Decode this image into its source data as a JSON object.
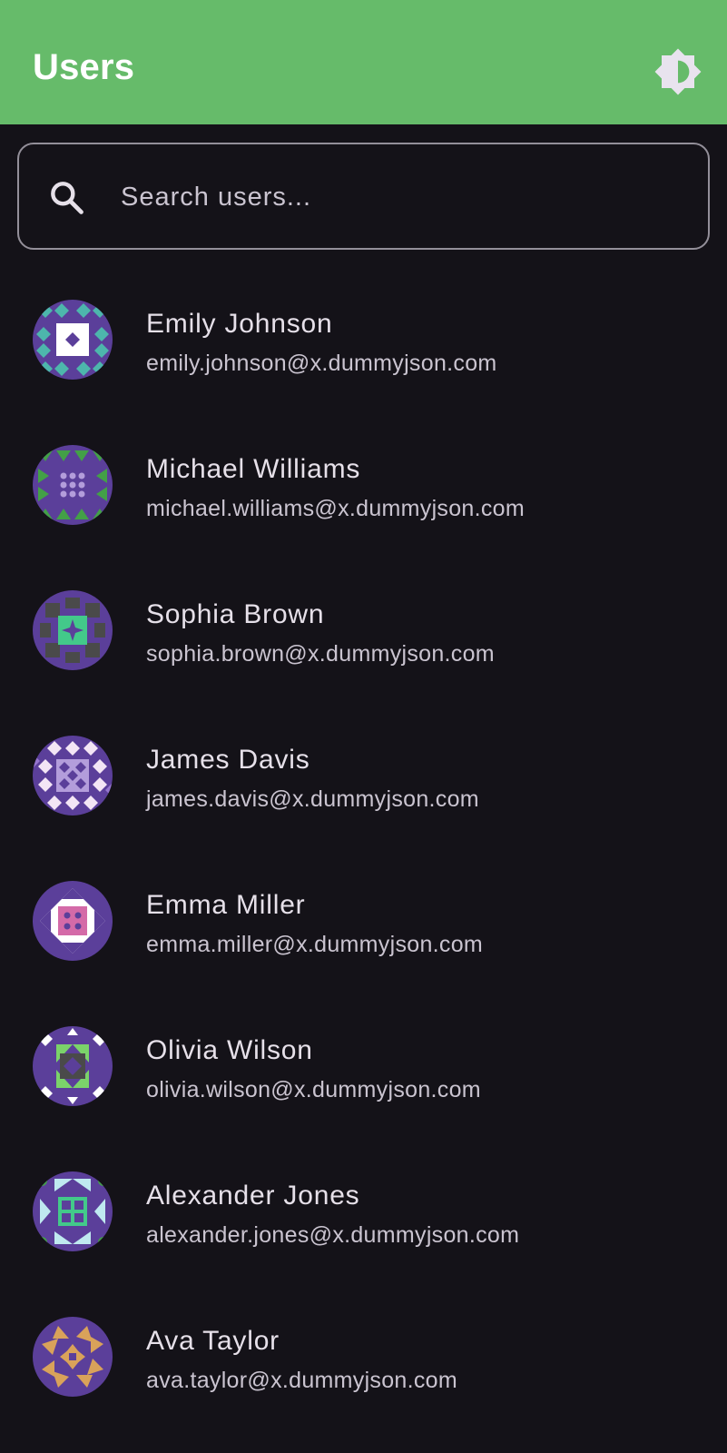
{
  "app_bar": {
    "title": "Users",
    "background": "#66bb6a",
    "theme_icon": "brightness-icon"
  },
  "search": {
    "placeholder": "Search users...",
    "value": "",
    "icon": "search-icon"
  },
  "users": [
    {
      "name": "Emily Johnson",
      "email": "emily.johnson@x.dummyjson.com"
    },
    {
      "name": "Michael Williams",
      "email": "michael.williams@x.dummyjson.com"
    },
    {
      "name": "Sophia Brown",
      "email": "sophia.brown@x.dummyjson.com"
    },
    {
      "name": "James Davis",
      "email": "james.davis@x.dummyjson.com"
    },
    {
      "name": "Emma Miller",
      "email": "emma.miller@x.dummyjson.com"
    },
    {
      "name": "Olivia Wilson",
      "email": "olivia.wilson@x.dummyjson.com"
    },
    {
      "name": "Alexander Jones",
      "email": "alexander.jones@x.dummyjson.com"
    },
    {
      "name": "Ava Taylor",
      "email": "ava.taylor@x.dummyjson.com"
    }
  ],
  "colors": {
    "background": "#141218",
    "avatar_base": "#5b3f9a",
    "primary_text": "#e6e0e9",
    "secondary_text": "#cac4d0",
    "outline": "#938f99"
  }
}
